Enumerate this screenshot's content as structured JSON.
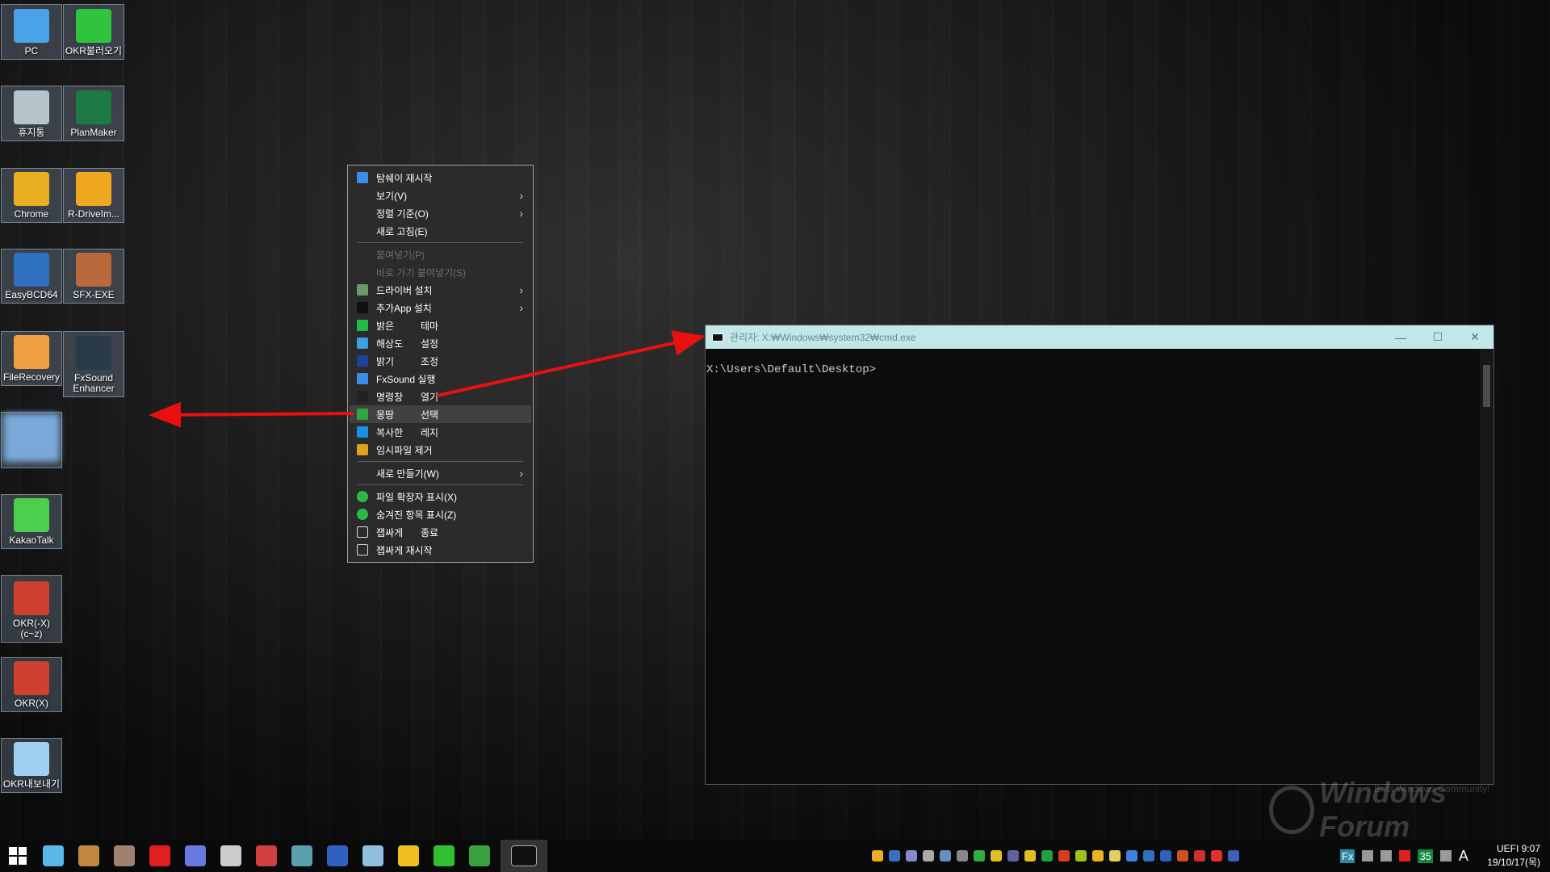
{
  "desktop": {
    "icons": [
      {
        "label": "PC",
        "color": "#4aa3e8"
      },
      {
        "label": "OKR불러오기",
        "color": "#2fc43c"
      },
      {
        "label": "휴지통",
        "color": "#b8c4cc"
      },
      {
        "label": "PlanMaker",
        "color": "#1e7a44"
      },
      {
        "label": "Chrome",
        "color": "#e8b020"
      },
      {
        "label": "R-DriveIm...",
        "color": "#f0a820"
      },
      {
        "label": "EasyBCD64",
        "color": "#3070c0"
      },
      {
        "label": "SFX-EXE",
        "color": "#b86a3c"
      },
      {
        "label": "FileRecovery",
        "color": "#f0a040"
      },
      {
        "label": "FxSound Enhancer",
        "color": "#2a3a48"
      },
      {
        "label": "",
        "color": "#7aa8d8"
      },
      {
        "label": "KakaoTalk",
        "color": "#4ccf4c"
      },
      {
        "label": "OKR(-X) (c~z)",
        "color": "#d04030"
      },
      {
        "label": "OKR(X)",
        "color": "#d04030"
      },
      {
        "label": "OKR내보내기",
        "color": "#9fd0f0"
      }
    ]
  },
  "context_menu": {
    "items": [
      {
        "label": "탐쉐이 재시작",
        "icon": "refresh-icon",
        "color": "#3a8ee8"
      },
      {
        "label": "보기(V)",
        "submenu": true
      },
      {
        "label": "정렬 기준(O)",
        "submenu": true
      },
      {
        "label": "새로 고침(E)"
      },
      {
        "sep": true
      },
      {
        "label": "붙여넣기(P)",
        "disabled": true
      },
      {
        "label": "바로 가기 붙여넣기(S)",
        "disabled": true
      },
      {
        "label": "드라이버 설치",
        "submenu": true,
        "icon": "driver-icon",
        "color": "#6a9a6a"
      },
      {
        "label": "추가App 설치",
        "submenu": true,
        "icon": "door-exit-icon",
        "color": "#111111"
      },
      {
        "label": "밝은",
        "label2": "테마",
        "icon": "theme-icon",
        "color": "#22bb44"
      },
      {
        "label": "해상도",
        "label2": "설정",
        "icon": "monitor-icon",
        "color": "#3aa0e0"
      },
      {
        "label": "밝기",
        "label2": "조정",
        "icon": "brightness-icon",
        "color": "#2040a0"
      },
      {
        "label": "FxSound 실행",
        "icon": "fxsound-icon",
        "color": "#3a8ee8"
      },
      {
        "label": "명령창",
        "label2": "열기",
        "icon": "cmd-icon",
        "color": "#222222"
      },
      {
        "label": "몽땅",
        "label2": "선택",
        "icon": "select-all-icon",
        "color": "#2fa840",
        "highlighted": true
      },
      {
        "label": "복사한",
        "label2": "레지",
        "icon": "registry-icon",
        "color": "#1a90e0"
      },
      {
        "label": "임시파일 제거",
        "icon": "broom-icon",
        "color": "#e0a020"
      },
      {
        "sep": true
      },
      {
        "label": "새로 만들기(W)",
        "submenu": true
      },
      {
        "sep": true
      },
      {
        "label": "파일 확장자 표시(X)",
        "icon": "check-icon",
        "color": "#2fb84a"
      },
      {
        "label": "숨겨진 항목 표시(Z)",
        "icon": "check-icon",
        "color": "#2fb84a"
      },
      {
        "label": "잽싸게",
        "label2": "종료",
        "icon": "window-close-icon",
        "color": "#2b2b2b"
      },
      {
        "label": "잽싸게 재시작",
        "icon": "window-restart-icon",
        "color": "#2b2b2b"
      }
    ]
  },
  "cmd": {
    "title": "관리자: X:₩Windows₩system32₩cmd.exe",
    "prompt": "X:\\Users\\Default\\Desktop>",
    "minimize": "—",
    "maximize": "☐",
    "close": "✕",
    "titlebar_color": "#c3e6e6"
  },
  "taskbar": {
    "apps": [
      {
        "name": "start",
        "color": "#ffffff"
      },
      {
        "name": "network-monitor",
        "color": "#5ab8e8"
      },
      {
        "name": "installer",
        "color": "#c08840"
      },
      {
        "name": "disc",
        "color": "#a08070"
      },
      {
        "name": "ntpwedit",
        "color": "#e02020"
      },
      {
        "name": "partition",
        "color": "#6a7ae0"
      },
      {
        "name": "disk-tool",
        "color": "#cccccc"
      },
      {
        "name": "recovery",
        "color": "#d04040"
      },
      {
        "name": "winntsetup",
        "color": "#5aa0b0"
      },
      {
        "name": "aomei",
        "color": "#3060c0"
      },
      {
        "name": "setup",
        "color": "#90c0e0"
      },
      {
        "name": "settings",
        "color": "#f0c020"
      },
      {
        "name": "sync",
        "color": "#30c030"
      },
      {
        "name": "hxd",
        "color": "#3aa040"
      },
      {
        "name": "cmd",
        "color": "#111111",
        "active": true
      }
    ],
    "tray_icons": [
      "#e8b020",
      "#3a70c0",
      "#8888cc",
      "#aaaaaa",
      "#6090c0",
      "#888888",
      "#30b040",
      "#e0c020",
      "#6060a0",
      "#e0c020",
      "#20a040",
      "#d04020",
      "#a0c020",
      "#f0b020",
      "#e0d060",
      "#4080e0",
      "#3070c0",
      "#3060c0",
      "#d05020",
      "#cc3030",
      "#e03030",
      "#4060c0"
    ],
    "tray_right": [
      "Fx",
      "grid",
      "network",
      "volume",
      "35",
      "pen",
      "A"
    ],
    "clock": {
      "line1": "UEFI  9:07",
      "line2": "19/10/17(목)"
    }
  },
  "watermark": {
    "text": "Windows Forum",
    "tagline": "Best Windows Community!"
  }
}
